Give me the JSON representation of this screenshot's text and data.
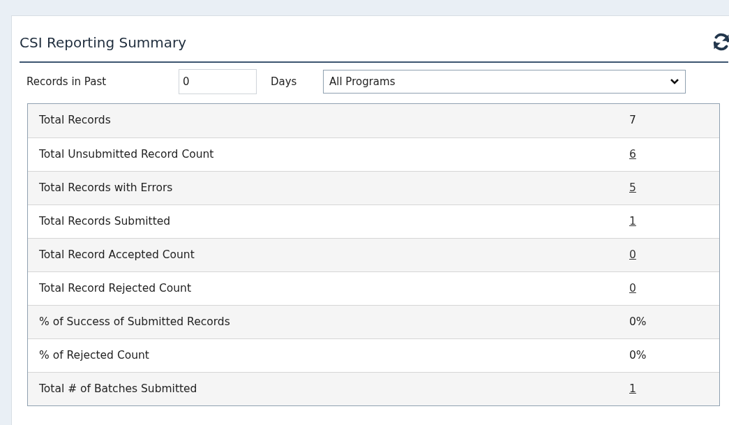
{
  "panel": {
    "title": "CSI Reporting Summary"
  },
  "filters": {
    "days_label_before": "Records in Past",
    "days_value": "0",
    "days_label_after": "Days",
    "program": "All Programs"
  },
  "rows": [
    {
      "label": "Total Records",
      "value": "7",
      "kind": "text"
    },
    {
      "label": "Total Unsubmitted Record Count",
      "value": "6",
      "kind": "link"
    },
    {
      "label": "Total Records with Errors",
      "value": "5",
      "kind": "link"
    },
    {
      "label": "Total Records Submitted",
      "value": "1",
      "kind": "link"
    },
    {
      "label": "Total Record Accepted Count",
      "value": "0",
      "kind": "link"
    },
    {
      "label": "Total Record Rejected Count",
      "value": "0",
      "kind": "link"
    },
    {
      "label": "% of Success of Submitted Records",
      "value": "0%",
      "kind": "text"
    },
    {
      "label": "% of Rejected Count",
      "value": "0%",
      "kind": "text"
    },
    {
      "label": "Total # of Batches Submitted",
      "value": "1",
      "kind": "link"
    }
  ]
}
